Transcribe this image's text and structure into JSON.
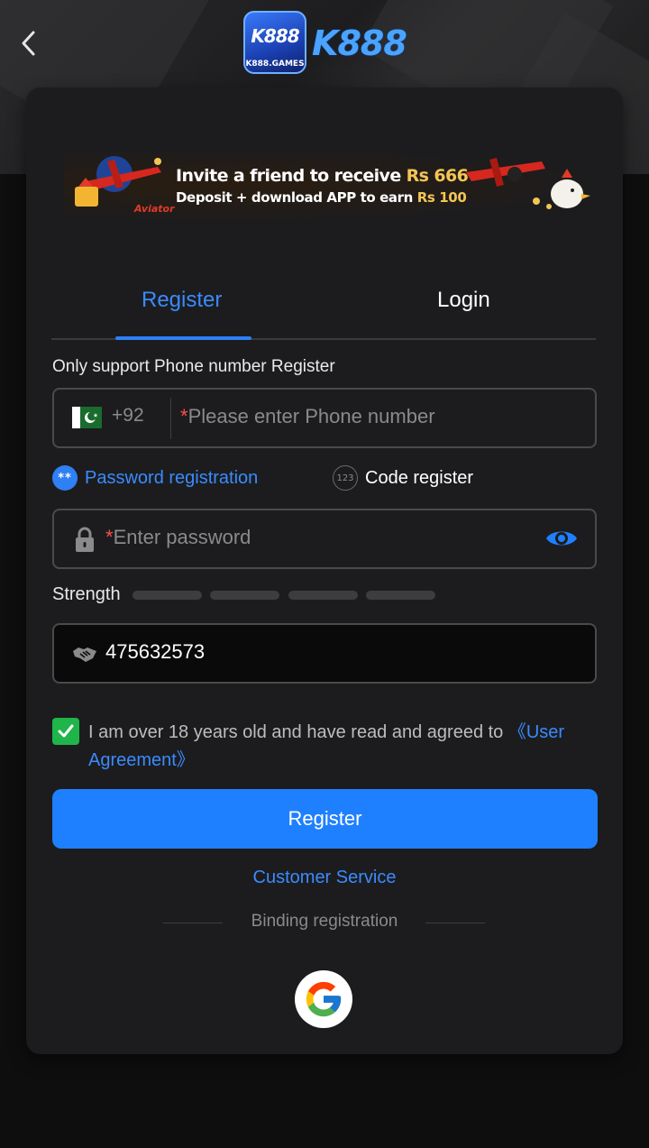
{
  "header": {
    "back_icon": "chevron-left-icon",
    "logo_badge_text": "K888",
    "logo_badge_subtext": "K888.GAMES",
    "logo_wordmark": "K888"
  },
  "banner": {
    "line1_prefix": "Invite a friend to receive",
    "line1_amount": "Rs 666",
    "line2_prefix": "Deposit + download APP to earn",
    "line2_amount": "Rs 100",
    "tag_text": "Aviator"
  },
  "tabs": {
    "register": "Register",
    "login": "Login",
    "active": "register"
  },
  "form": {
    "hint": "Only support Phone number Register",
    "country_code": "+92",
    "required_mark": "*",
    "phone_placeholder": "Please enter Phone number",
    "mode_password_label": "Password registration",
    "mode_password_icon_text": "**",
    "mode_code_label": "Code register",
    "mode_code_icon_text": "123",
    "password_placeholder": "Enter password",
    "strength_label": "Strength",
    "strength_level": 0,
    "invite_code": "475632573",
    "agree_text": "I am over 18 years old and have read and agreed to ",
    "agree_link": "《User Agreement》",
    "agree_checked": true,
    "register_button": "Register",
    "customer_service": "Customer Service",
    "binding_label": "Binding registration"
  },
  "colors": {
    "accent": "#1f80ff",
    "link": "#3a8bff",
    "checkbox": "#1fb54a",
    "required": "#ff4d4d",
    "card_bg": "#1c1c1e"
  }
}
